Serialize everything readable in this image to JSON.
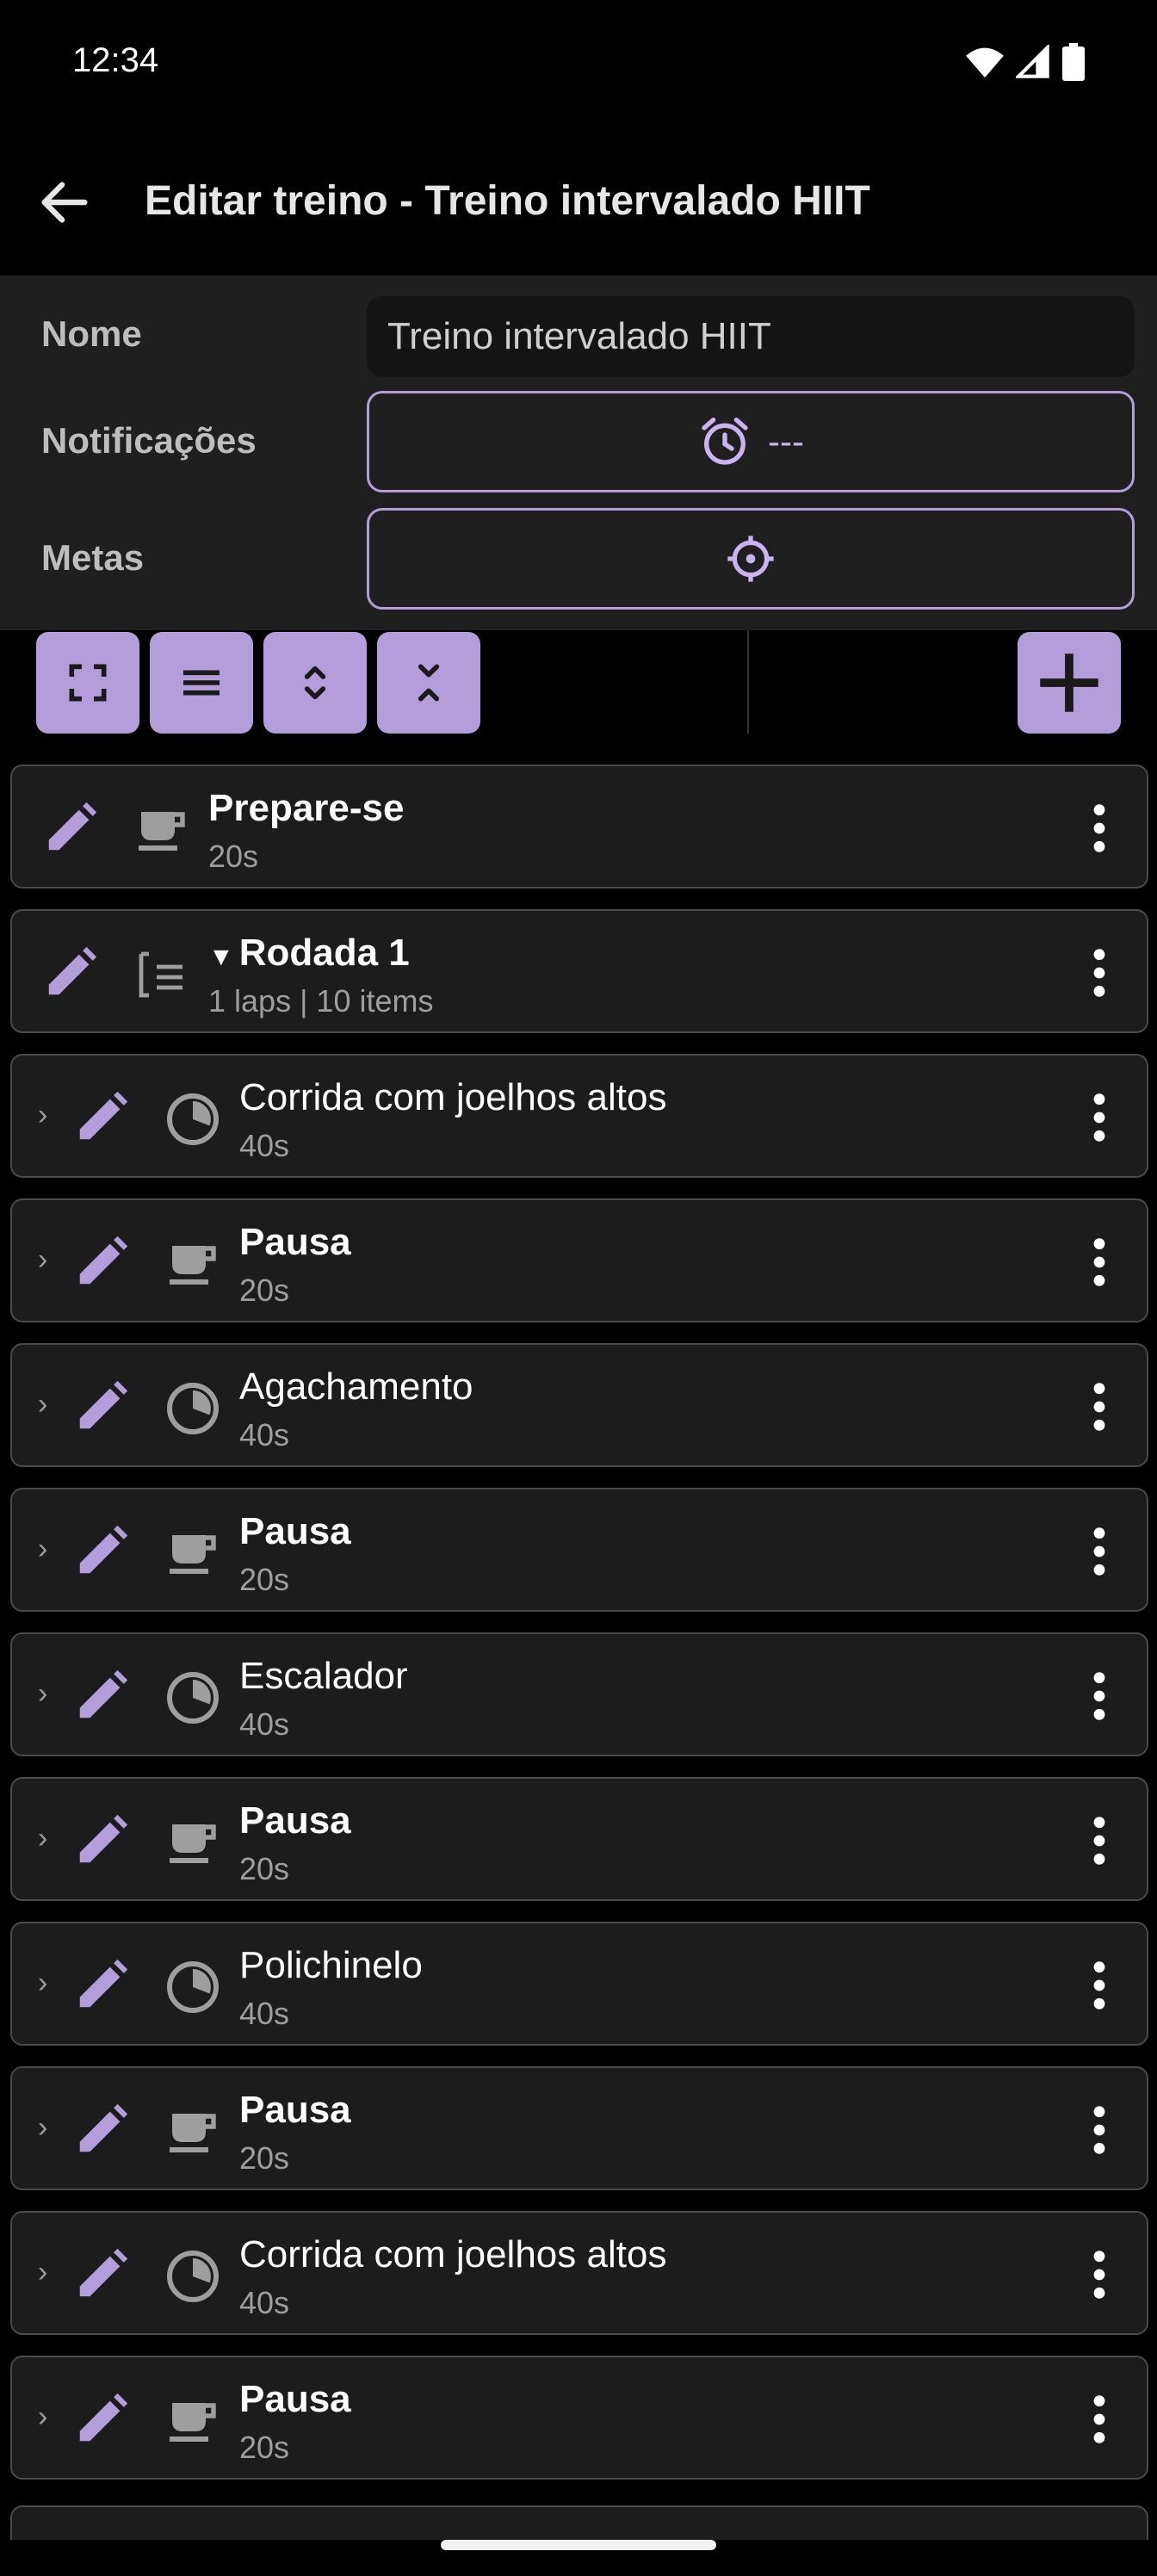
{
  "status_bar": {
    "time": "12:34"
  },
  "app_bar": {
    "title": "Editar treino - Treino intervalado HIIT"
  },
  "form": {
    "name_label": "Nome",
    "name_value": "Treino intervalado HIIT",
    "notifications_label": "Notificações",
    "notifications_value": "---",
    "goals_label": "Metas"
  },
  "colors": {
    "accent": "#b39ddb",
    "background": "#000000",
    "panel": "#1f1f1f",
    "card": "#1c1c1c"
  },
  "list": {
    "items": [
      {
        "title": "Prepare-se",
        "sub": "20s",
        "icon": "cup-icon",
        "bold": true,
        "level": 0
      },
      {
        "title": "Rodada 1",
        "sub": "1 laps | 10 items",
        "icon": "list-icon",
        "bold": true,
        "level": 0,
        "expanded": true
      },
      {
        "title": "Corrida com joelhos altos",
        "sub": "40s",
        "icon": "timer-pie-icon",
        "bold": false,
        "level": 1
      },
      {
        "title": "Pausa",
        "sub": "20s",
        "icon": "cup-icon",
        "bold": true,
        "level": 1
      },
      {
        "title": "Agachamento",
        "sub": "40s",
        "icon": "timer-pie-icon",
        "bold": false,
        "level": 1
      },
      {
        "title": "Pausa",
        "sub": "20s",
        "icon": "cup-icon",
        "bold": true,
        "level": 1
      },
      {
        "title": "Escalador",
        "sub": "40s",
        "icon": "timer-pie-icon",
        "bold": false,
        "level": 1
      },
      {
        "title": "Pausa",
        "sub": "20s",
        "icon": "cup-icon",
        "bold": true,
        "level": 1
      },
      {
        "title": "Polichinelo",
        "sub": "40s",
        "icon": "timer-pie-icon",
        "bold": false,
        "level": 1
      },
      {
        "title": "Pausa",
        "sub": "20s",
        "icon": "cup-icon",
        "bold": true,
        "level": 1
      },
      {
        "title": "Corrida com joelhos altos",
        "sub": "40s",
        "icon": "timer-pie-icon",
        "bold": false,
        "level": 1
      },
      {
        "title": "Pausa",
        "sub": "20s",
        "icon": "cup-icon",
        "bold": true,
        "level": 1
      }
    ]
  }
}
